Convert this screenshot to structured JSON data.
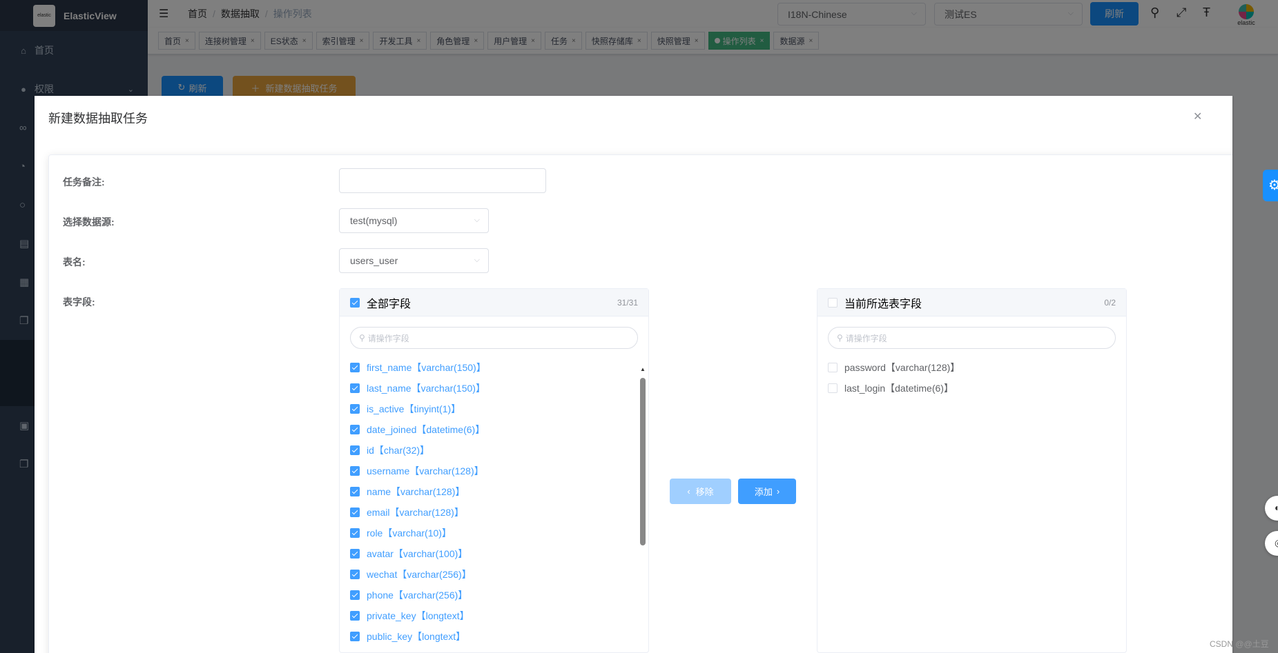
{
  "app": {
    "logo_text": "elastic",
    "title": "ElasticView"
  },
  "sidebar": {
    "home": "首页",
    "permissions": "权限"
  },
  "header": {
    "breadcrumb": [
      "首页",
      "数据抽取",
      "操作列表"
    ],
    "language_select": "I18N-Chinese",
    "connection_select": "测试ES",
    "refresh_button": "刷新",
    "avatar_label": "elastic"
  },
  "tags": [
    {
      "label": "首页"
    },
    {
      "label": "连接树管理"
    },
    {
      "label": "ES状态"
    },
    {
      "label": "索引管理"
    },
    {
      "label": "开发工具"
    },
    {
      "label": "角色管理"
    },
    {
      "label": "用户管理"
    },
    {
      "label": "任务"
    },
    {
      "label": "快照存储库"
    },
    {
      "label": "快照管理"
    },
    {
      "label": "操作列表",
      "active": true
    },
    {
      "label": "数据源"
    }
  ],
  "page": {
    "refresh_button": "刷新",
    "new_task_button": "新建数据抽取任务"
  },
  "dialog": {
    "title": "新建数据抽取任务",
    "form": {
      "remark_label": "任务备注:",
      "remark_value": "",
      "datasource_label": "选择数据源:",
      "datasource_value": "test(mysql)",
      "table_label": "表名:",
      "table_value": "users_user",
      "fields_label": "表字段:"
    },
    "left_panel": {
      "title": "全部字段",
      "count": "31/31",
      "search_placeholder": "请操作字段",
      "items": [
        "first_name【varchar(150)】",
        "last_name【varchar(150)】",
        "is_active【tinyint(1)】",
        "date_joined【datetime(6)】",
        "id【char(32)】",
        "username【varchar(128)】",
        "name【varchar(128)】",
        "email【varchar(128)】",
        "role【varchar(10)】",
        "avatar【varchar(100)】",
        "wechat【varchar(256)】",
        "phone【varchar(256)】",
        "private_key【longtext】",
        "public_key【longtext】"
      ]
    },
    "right_panel": {
      "title": "当前所选表字段",
      "count": "0/2",
      "search_placeholder": "请操作字段",
      "items": [
        "password【varchar(128)】",
        "last_login【datetime(6)】"
      ]
    },
    "remove_button": "移除",
    "add_button": "添加"
  },
  "watermark": "CSDN @@土豆",
  "colors": {
    "primary": "#1890ff",
    "tag_active": "#42b983",
    "warning": "#e6a23c",
    "sidebar": "#304156"
  }
}
